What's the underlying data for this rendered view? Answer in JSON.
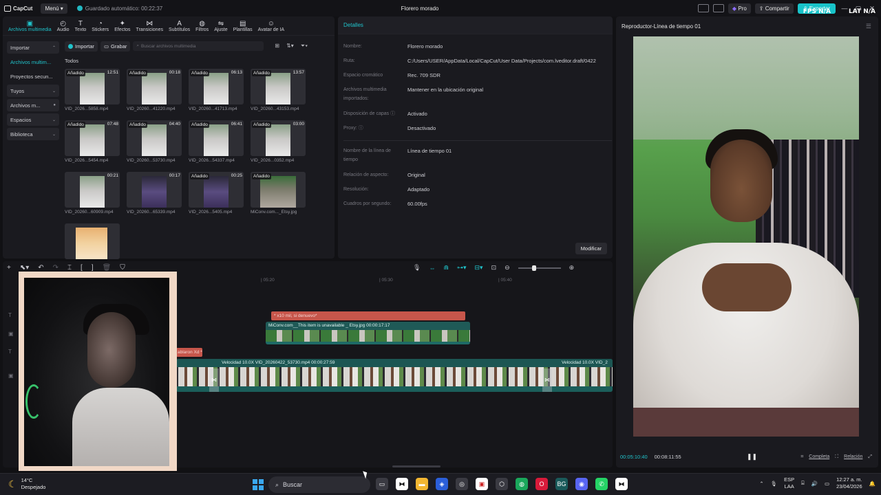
{
  "titlebar": {
    "logo": "CapCut",
    "menu_label": "Menú",
    "autosave": "Guardado automático: 00:22:37",
    "project_name": "Florero morado",
    "pro_label": "Pro",
    "share_label": "Compartir",
    "export_label": "Exportar",
    "fps_overlay": [
      "FPS N/A",
      "LAT N/A"
    ]
  },
  "toolbar": {
    "tools": [
      {
        "label": "Archivos multimedia",
        "icon": "media-icon"
      },
      {
        "label": "Audio",
        "icon": "audio-icon"
      },
      {
        "label": "Texto",
        "icon": "text-icon"
      },
      {
        "label": "Stickers",
        "icon": "sticker-icon"
      },
      {
        "label": "Efectos",
        "icon": "effects-icon"
      },
      {
        "label": "Transiciones",
        "icon": "transitions-icon"
      },
      {
        "label": "Subtítulos",
        "icon": "captions-icon"
      },
      {
        "label": "Filtros",
        "icon": "filters-icon"
      },
      {
        "label": "Ajuste",
        "icon": "adjust-icon"
      },
      {
        "label": "Plantillas",
        "icon": "templates-icon"
      },
      {
        "label": "Avatar de IA",
        "icon": "ai-avatar-icon"
      }
    ]
  },
  "sidebar": {
    "items": [
      {
        "label": "Importar",
        "chevron": "^"
      },
      {
        "label": "Archivos multim...",
        "chevron": ""
      },
      {
        "label": "Proyectos secun...",
        "chevron": ""
      },
      {
        "label": "Tuyos",
        "chevron": "v"
      },
      {
        "label": "Archivos m...",
        "chevron": "•"
      },
      {
        "label": "Espacios",
        "chevron": "v"
      },
      {
        "label": "Biblioteca",
        "chevron": "v"
      }
    ]
  },
  "media": {
    "import_label": "Importar",
    "record_label": "Grabar",
    "search_placeholder": "Buscar archivos multimedia",
    "section_label": "Todos",
    "added_badge": "Añadido",
    "items": [
      {
        "name": "VID_2026...5858.mp4",
        "duration": "12:51",
        "added": true
      },
      {
        "name": "VID_20260...41220.mp4",
        "duration": "00:18",
        "added": true
      },
      {
        "name": "VID_20260...41713.mp4",
        "duration": "06:13",
        "added": true
      },
      {
        "name": "VID_20260...43153.mp4",
        "duration": "13:57",
        "added": true
      },
      {
        "name": "VID_2026...5454.mp4",
        "duration": "07:48",
        "added": true
      },
      {
        "name": "VID_20260...53730.mp4",
        "duration": "04:40",
        "added": true
      },
      {
        "name": "VID_2026...54337.mp4",
        "duration": "06:41",
        "added": true
      },
      {
        "name": "VID_2026...0352.mp4",
        "duration": "03:00",
        "added": true
      },
      {
        "name": "VID_20260...60909.mp4",
        "duration": "00:21",
        "added": false
      },
      {
        "name": "VID_20260...65339.mp4",
        "duration": "00:17",
        "added": false
      },
      {
        "name": "VID_2026...5405.mp4",
        "duration": "00:25",
        "added": true
      },
      {
        "name": "MiConv.com..._Etsy.jpg",
        "duration": "",
        "added": true
      },
      {
        "name": "",
        "duration": "",
        "added": false
      }
    ]
  },
  "details": {
    "title": "Detalles",
    "rows": [
      {
        "label": "Nombre:",
        "value": "Florero morado"
      },
      {
        "label": "Ruta:",
        "value": "C:/Users/USER/AppData/Local/CapCut/User Data/Projects/com.lveditor.draft/0422"
      },
      {
        "label": "Espacio cromático",
        "value": "Rec. 709 SDR"
      },
      {
        "label": "Archivos multimedia importados:",
        "value": "Mantener en la ubicación original"
      },
      {
        "label": "Disposición de capas ⓘ",
        "value": "Activado"
      },
      {
        "label": "Proxy: ⓘ",
        "value": "Desactivado"
      },
      {
        "label": "Nombre de la línea de tiempo",
        "value": "Línea de tiempo 01"
      },
      {
        "label": "Relación de aspecto:",
        "value": "Original"
      },
      {
        "label": "Resolución:",
        "value": "Adaptado"
      },
      {
        "label": "Cuadros por segundo:",
        "value": "60.00fps"
      }
    ],
    "modify_label": "Modificar"
  },
  "player": {
    "title": "Reproductor-Línea de tiempo 01",
    "current_time": "00:05:10:40",
    "total_time": "00:08:11:55",
    "full_label": "Completa",
    "ratio_label": "Relación"
  },
  "timeline": {
    "ruler": [
      "| 05:20",
      "| 05:30",
      "| 05:40"
    ],
    "text_clip": "* x10 mil, si denuevo*",
    "image_clip_label": "MiConv.com__This item is unavailable _ Etsy.jpg  00:00:17:17",
    "text_clip2": "ablaron Xd *",
    "main_clip_label": "Velocidad 10.0X   VID_20260422_53730.mp4   00:00:27:59",
    "main_clip_label2": "Velocidad 10.0X   VID_2"
  },
  "taskbar": {
    "temp": "14°C",
    "weather": "Despejado",
    "search_label": "Buscar",
    "lang": "ESP",
    "layout": "LAA",
    "time": "12:27 a. m.",
    "date": "23/04/2026"
  }
}
